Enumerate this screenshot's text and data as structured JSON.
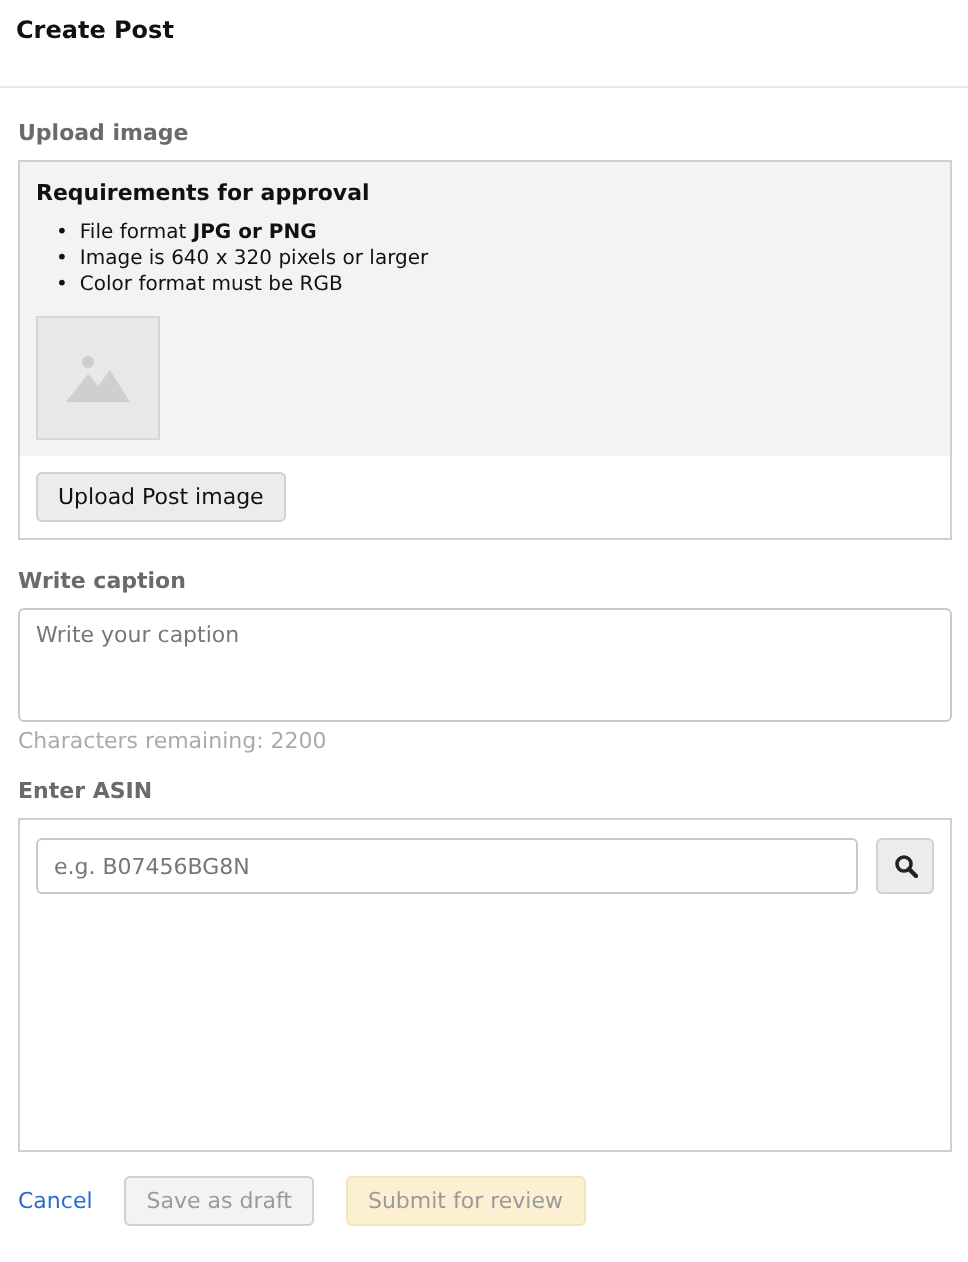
{
  "title": "Create Post",
  "upload": {
    "label": "Upload image",
    "requirements_title": "Requirements for approval",
    "requirements": [
      {
        "bullet": "•",
        "text": "File format **JPG or PNG**"
      },
      {
        "bullet": "•",
        "text": "Image is 640 x 320 pixels or larger"
      },
      {
        "bullet": "•",
        "text": "Color format must be RGB"
      }
    ],
    "button": "Upload Post image"
  },
  "caption": {
    "label": "Write caption",
    "placeholder": "Write your caption",
    "remaining": "Characters remaining: 2200"
  },
  "asin": {
    "label": "Enter ASIN",
    "placeholder": "e.g. B07456BG8N"
  },
  "actions": [
    {
      "kind": "link",
      "label": "Cancel",
      "disabled": false
    },
    {
      "kind": "secondary",
      "label": "Save as draft",
      "disabled": true
    },
    {
      "kind": "primary",
      "label": "Submit for review",
      "disabled": true
    }
  ]
}
